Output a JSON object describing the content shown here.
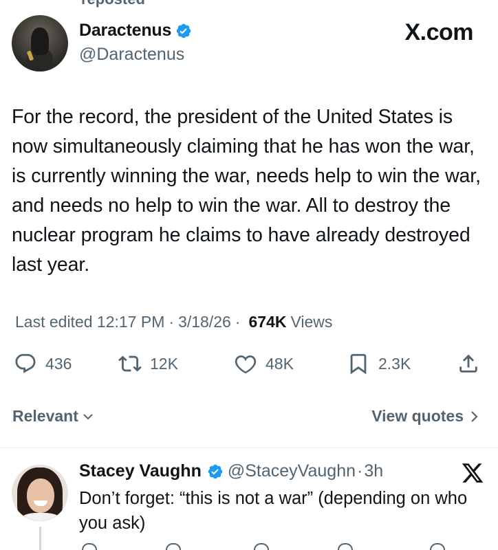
{
  "header": {
    "reposted_label": "reposted",
    "site": "X.com"
  },
  "tweet": {
    "author": {
      "name": "Daractenus",
      "handle": "@Daractenus",
      "verified": true
    },
    "text": "For the record, the president of the United States is now simultaneously claiming that he has won the war, is currently winning the war, needs help to win the war, and needs no help to win the war. All to destroy the nuclear program he claims to have already destroyed last year.",
    "meta": {
      "edited": "Last edited 12:17 PM",
      "dot1": "·",
      "date": "3/18/26",
      "dot2": "·",
      "views_count": "674K",
      "views_label": "Views"
    },
    "actions": {
      "replies": "436",
      "reposts": "12K",
      "likes": "48K",
      "bookmarks": "2.3K"
    }
  },
  "sort": {
    "label": "Relevant",
    "view_quotes": "View quotes"
  },
  "reply": {
    "name": "Stacey Vaughn",
    "handle": "@StaceyVaughn",
    "dot": "·",
    "time": "3h",
    "text": "Don’t forget: “this is not a war” (depending on who you ask)"
  },
  "colors": {
    "text": "#0f1419",
    "secondary": "#536471",
    "verified": "#1d9bf0",
    "divider": "#eff3f4"
  },
  "icons": {
    "verified": "verified-badge-icon",
    "reply": "reply-bubble-icon",
    "repost": "repost-arrows-icon",
    "like": "heart-icon",
    "bookmark": "bookmark-icon",
    "share": "share-upload-icon",
    "chevron_down": "chevron-down-icon",
    "chevron_right": "chevron-right-icon",
    "x_logo": "x-logo-icon"
  }
}
